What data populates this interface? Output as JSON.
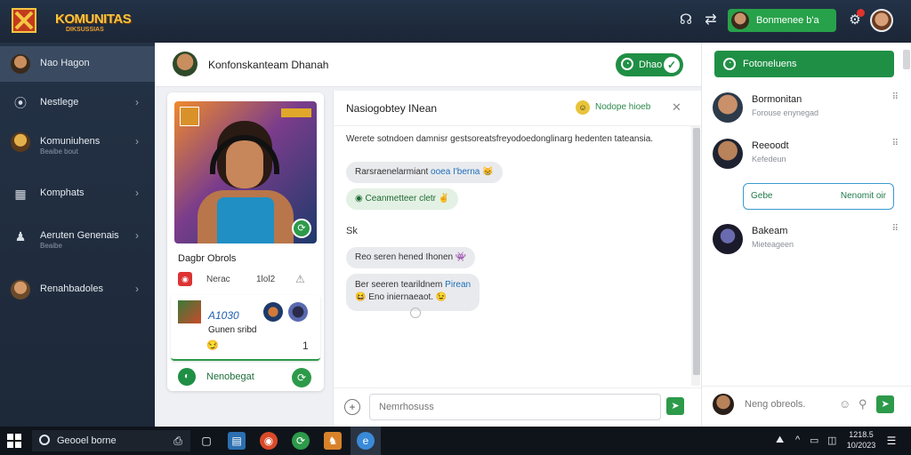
{
  "app": {
    "logo_text": "KOMUNITAS",
    "logo_sub": "DIKSUSSIAS",
    "user_pill": "Bonmenee b'a",
    "accent": "#1f8f45"
  },
  "sidebar": {
    "items": [
      {
        "label": "Nao Hagon",
        "sub": "",
        "icon": "avatar-icon"
      },
      {
        "label": "Nestlege",
        "sub": "",
        "icon": "location-pin-icon"
      },
      {
        "label": "Komuniuhens",
        "sub": "Beaibe bout",
        "icon": "community-icon"
      },
      {
        "label": "Komphats",
        "sub": "",
        "icon": "folder-icon"
      },
      {
        "label": "Aeruten Genenais",
        "sub": "Beaibe",
        "icon": "user-icon"
      },
      {
        "label": "Renahbadoles",
        "sub": "",
        "icon": "group-avatar-icon"
      }
    ]
  },
  "header": {
    "title": "Konfonskanteam Dhanah",
    "button_label": "Dhao"
  },
  "game_card": {
    "title": "Dagbr Obrols",
    "stat_a": "Nerac",
    "stat_b": "1lol2",
    "sub_number": "A1030",
    "sub_text": "Gunen sribd",
    "sub_count": "1",
    "footer_label": "Nenobegat"
  },
  "chat": {
    "title": "Nasiogobtey INean",
    "status": "Nodope hioeb",
    "intro": "Werete sotndoen damnisr gestsoreatsfreyodoedonglinarg hedenten tateansia.",
    "messages": [
      {
        "text": "Rarsraenelarmiant",
        "link": "ooea I'berna"
      },
      {
        "text": "Ceanmetteer cletr"
      },
      {
        "text": "Reo seren hened Ihonen"
      },
      {
        "text": "Ber seeren tearildnem",
        "link": "Pirean",
        "line2": "Eno iniernaeaot."
      }
    ],
    "sender_mark": "Sk",
    "input_placeholder": "Nemrhosuss"
  },
  "right_panel": {
    "header": "Fotoneluens",
    "contacts": [
      {
        "name": "Bormonitan",
        "status": "Forouse enynegad"
      },
      {
        "name": "Reeoodt",
        "status": "Kefedeun"
      },
      {
        "name": "Bakeam",
        "status": "Mieteageen"
      }
    ],
    "pill_a": "Gebe",
    "pill_b": "Nenomit oir",
    "footer_text": "Neng obreols."
  },
  "taskbar": {
    "search_text": "Geooel borne",
    "clock_time": "1218.5",
    "clock_date": "10/2023"
  }
}
